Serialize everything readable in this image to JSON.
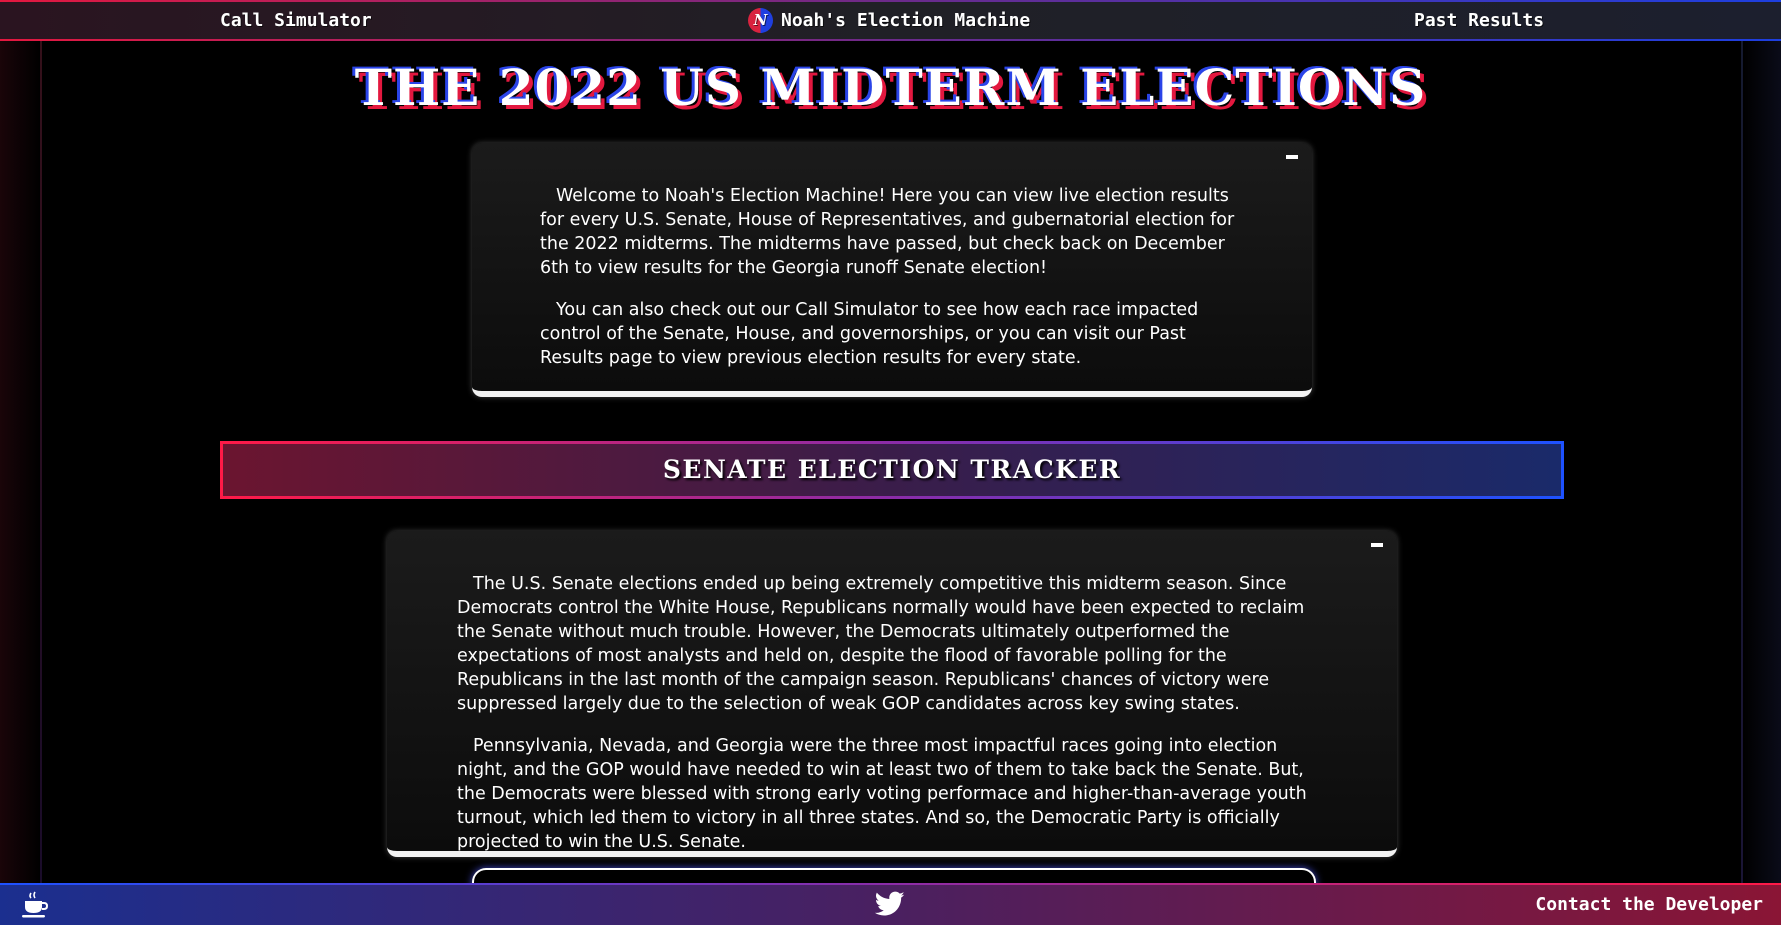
{
  "nav": {
    "left_link": "Call Simulator",
    "brand_logo_letter": "N",
    "brand_name": "Noah's Election Machine",
    "right_link": "Past Results"
  },
  "page_title": "THE 2022 US MIDTERM ELECTIONS",
  "intro_card": {
    "collapse_label": "-",
    "paragraphs": [
      "Welcome to Noah's Election Machine! Here you can view live election results for every U.S. Senate, House of Representatives, and gubernatorial election for the 2022 midterms. The midterms have passed, but check back on December 6th to view results for the Georgia runoff Senate election!",
      "You can also check out our Call Simulator to see how each race impacted control of the Senate, House, and governorships, or you can visit our Past Results page to view previous election results for every state."
    ]
  },
  "senate_tracker": {
    "heading": "SENATE ELECTION TRACKER"
  },
  "senate_card": {
    "collapse_label": "-",
    "paragraphs": [
      "The U.S. Senate elections ended up being extremely competitive this midterm season. Since Democrats control the White House, Republicans normally would have been expected to reclaim the Senate without much trouble. However, the Democrats ultimately outperformed the expectations of most analysts and held on, despite the flood of favorable polling for the Republicans in the last month of the campaign season. Republicans' chances of victory were suppressed largely due to the selection of weak GOP candidates across key swing states.",
      "Pennsylvania, Nevada, and Georgia were the three most impactful races going into election night, and the GOP would have needed to win at least two of them to take back the Senate. But, the Democrats were blessed with strong early voting performace and higher-than-average youth turnout, which led them to victory in all three states. And so, the Democratic Party is officially projected to win the U.S. Senate."
    ]
  },
  "footer": {
    "left_icon": "coffee-cup-icon",
    "center_icon": "twitter-bird-icon",
    "contact_link": "Contact the Developer"
  },
  "colors": {
    "republican_red": "#e3183f",
    "democrat_blue": "#1e52ff",
    "background": "#000000"
  }
}
